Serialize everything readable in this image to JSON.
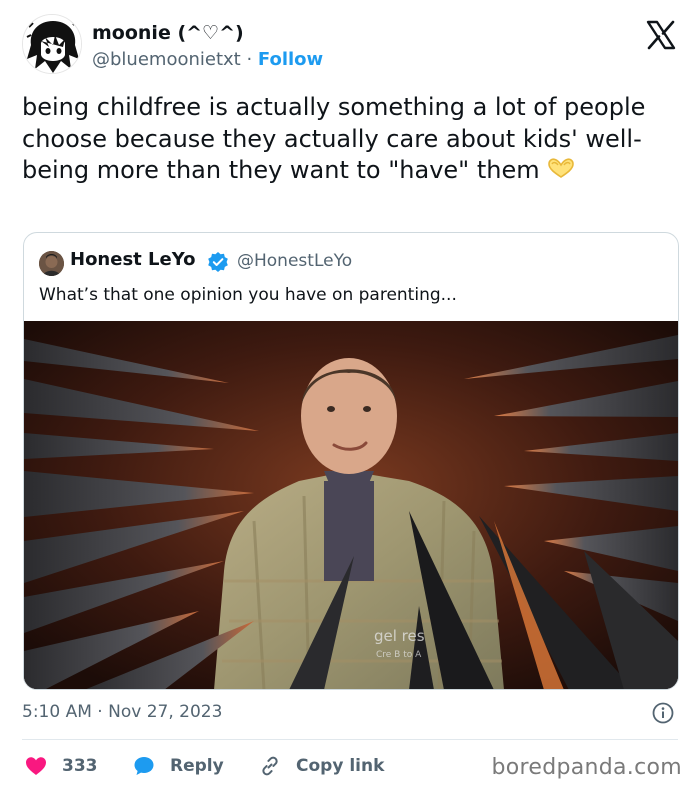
{
  "author": {
    "display_name": "moonie (^♡^)",
    "handle": "@bluemoonietxt",
    "separator": " · ",
    "follow_label": "Follow"
  },
  "icons": {
    "platform_logo": "x-logo-icon",
    "reaction_emoji": "heart-hands-icon",
    "verified": "verified-badge-icon",
    "info": "info-icon",
    "like": "heart-icon",
    "reply": "reply-bubble-icon",
    "copy": "link-icon"
  },
  "tweet": {
    "text": "being childfree is actually something a lot of people choose because they actually care about kids' well-being more than they want to \"have\" them"
  },
  "quoted": {
    "display_name": "Honest LeYo",
    "handle": "@HonestLeYo",
    "text": "What’s that one opinion you have on parenting...",
    "media_caption": "gel   res",
    "media_subcaption": "Cre    B    to A"
  },
  "meta": {
    "time": "5:10 AM",
    "separator": " · ",
    "date": "Nov 27, 2023"
  },
  "actions": {
    "like_count": "333",
    "reply_label": "Reply",
    "copy_label": "Copy link"
  },
  "watermark": "boredpanda.com",
  "colors": {
    "accent": "#1d9bf0",
    "like": "#f91880",
    "text": "#0f1419",
    "muted": "#536471"
  }
}
